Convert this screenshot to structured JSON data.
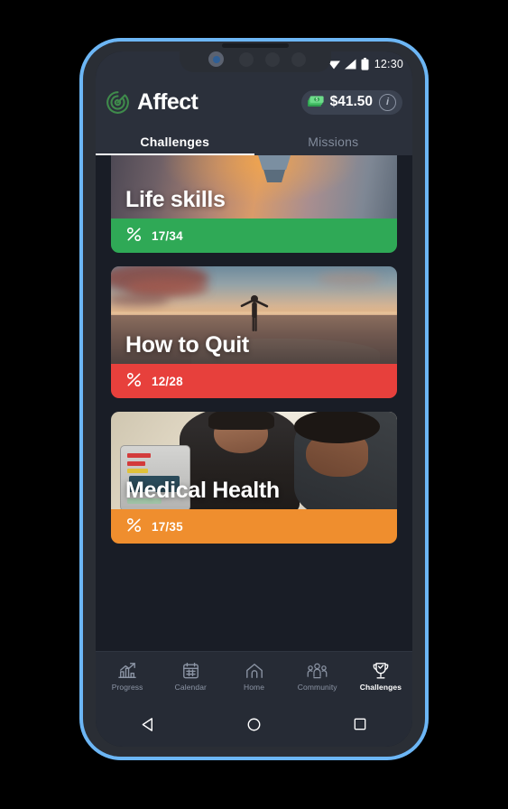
{
  "status_bar": {
    "time": "12:30",
    "icons": [
      "wifi-icon",
      "signal-icon",
      "battery-icon"
    ]
  },
  "header": {
    "brand": "Affect",
    "logo_icon": "affect-spiral-logo",
    "logo_color": "#3f8a4b",
    "wallet": {
      "icon": "money-stack-icon",
      "amount": "$41.50",
      "info_label": "i"
    }
  },
  "tabs": [
    {
      "label": "Challenges",
      "active": true
    },
    {
      "label": "Missions",
      "active": false
    }
  ],
  "cards": [
    {
      "title": "Life skills",
      "progress": "17/34",
      "color": "#2fa956",
      "icon": "percent-icon",
      "image": "lightbulb-sunset",
      "clipped": true
    },
    {
      "title": "How to Quit",
      "progress": "12/28",
      "color": "#e7403c",
      "icon": "percent-icon",
      "image": "person-on-rock-sunset",
      "clipped": false
    },
    {
      "title": "Medical Health",
      "progress": "17/35",
      "color": "#ef8e2e",
      "icon": "percent-icon",
      "image": "nurse-with-patient",
      "clipped": false
    }
  ],
  "bottom_nav": [
    {
      "label": "Progress",
      "icon": "chart-growth-icon",
      "active": false
    },
    {
      "label": "Calendar",
      "icon": "calendar-icon",
      "active": false
    },
    {
      "label": "Home",
      "icon": "home-icon",
      "active": false
    },
    {
      "label": "Community",
      "icon": "people-group-icon",
      "active": false
    },
    {
      "label": "Challenges",
      "icon": "trophy-check-icon",
      "active": true
    }
  ],
  "system_nav": [
    {
      "name": "back-button",
      "icon": "triangle-left-icon"
    },
    {
      "name": "home-button",
      "icon": "circle-icon"
    },
    {
      "name": "recents-button",
      "icon": "square-icon"
    }
  ],
  "theme": {
    "screen_bg": "#191d26",
    "chrome_bg": "#2b303b",
    "nav_bg": "#262b35",
    "frame_blue": "#6cb6f5",
    "bezel": "#2a2e35"
  }
}
